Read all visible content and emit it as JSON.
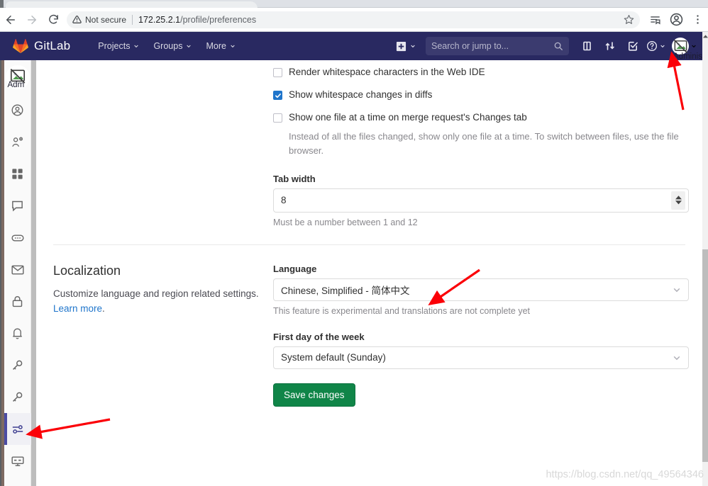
{
  "browser": {
    "back_icon": "arrow-left-icon",
    "forward_icon": "arrow-right-icon",
    "reload_icon": "reload-icon",
    "security_warning_icon": "warning-triangle-icon",
    "security_label": "Not secure",
    "url_host": "172.25.2.1",
    "url_path": "/profile/preferences",
    "bookmark_icon": "star-icon",
    "reading_list_icon": "reading-list-icon",
    "profile_icon": "profile-avatar-icon",
    "menu_icon": "three-dot-menu-icon"
  },
  "navbar": {
    "brand": "GitLab",
    "logo_icon": "gitlab-tanuki-logo",
    "links": [
      {
        "label": "Projects",
        "icon": "chevron-down-icon"
      },
      {
        "label": "Groups",
        "icon": "chevron-down-icon"
      },
      {
        "label": "More",
        "icon": "chevron-down-icon"
      }
    ],
    "create_new_icon": "plus-square-icon",
    "search": {
      "placeholder": "Search or jump to...",
      "icon": "search-icon"
    },
    "icons": [
      "issues-board-icon",
      "merge-requests-icon",
      "todos-checkbox-icon"
    ],
    "help_icon": "question-circle-icon",
    "user": {
      "avatar_icon": "broken-image-icon",
      "alt_text": "Administrat",
      "caret_icon": "chevron-down-icon"
    }
  },
  "sidebar": {
    "avatar": {
      "icon": "broken-image-icon",
      "alt_text": "Adm"
    },
    "items": [
      {
        "name": "profile",
        "icon": "user-circle-icon",
        "active": false
      },
      {
        "name": "account",
        "icon": "user-settings-icon",
        "active": false
      },
      {
        "name": "applications",
        "icon": "grid-apps-icon",
        "active": false
      },
      {
        "name": "chat",
        "icon": "chat-bubble-icon",
        "active": false
      },
      {
        "name": "integrations",
        "icon": "comment-dots-icon",
        "active": false
      },
      {
        "name": "notifications-email",
        "icon": "envelope-icon",
        "active": false
      },
      {
        "name": "password",
        "icon": "lock-icon",
        "active": false
      },
      {
        "name": "notifications",
        "icon": "bell-icon",
        "active": false
      },
      {
        "name": "ssh-keys",
        "icon": "key-icon",
        "active": false
      },
      {
        "name": "gpg-keys",
        "icon": "key-icon",
        "active": false
      },
      {
        "name": "preferences",
        "icon": "preferences-sliders-icon",
        "active": true
      },
      {
        "name": "active-sessions",
        "icon": "monitor-icon",
        "active": false
      }
    ]
  },
  "main": {
    "checkboxes": [
      {
        "label": "Render whitespace characters in the Web IDE",
        "checked": false
      },
      {
        "label": "Show whitespace changes in diffs",
        "checked": true
      },
      {
        "label": "Show one file at a time on merge request's Changes tab",
        "checked": false
      }
    ],
    "one_file_help": "Instead of all the files changed, show only one file at a time. To switch between files, use the file browser.",
    "tab_width": {
      "label": "Tab width",
      "value": "8",
      "hint": "Must be a number between 1 and 12",
      "spinner_icon": "spinner-up-down-icon"
    },
    "localization": {
      "title": "Localization",
      "description_before": "Customize language and region related settings.",
      "learn_more": "Learn more",
      "description_after": ".",
      "language": {
        "label": "Language",
        "value": "Chinese, Simplified - 简体中文",
        "hint": "This feature is experimental and translations are not complete yet",
        "chevron_icon": "chevron-down-icon"
      },
      "first_day": {
        "label": "First day of the week",
        "value": "System default (Sunday)",
        "chevron_icon": "chevron-down-icon"
      },
      "save_label": "Save changes"
    }
  },
  "watermark": "https://blog.csdn.net/qq_49564346",
  "annotations": {
    "arrow_color": "#fb0007",
    "arrows": [
      {
        "name": "arrow-to-user-menu",
        "points": "to navbar user avatar"
      },
      {
        "name": "arrow-to-language-select",
        "points": "to Language dropdown"
      },
      {
        "name": "arrow-to-preferences-rail-item",
        "points": "to preferences sidebar icon"
      }
    ]
  },
  "colors": {
    "navbar_bg": "#292961",
    "accent_blue": "#1f75cb",
    "save_green": "#108548",
    "rail_active": "#4b4ba3"
  }
}
